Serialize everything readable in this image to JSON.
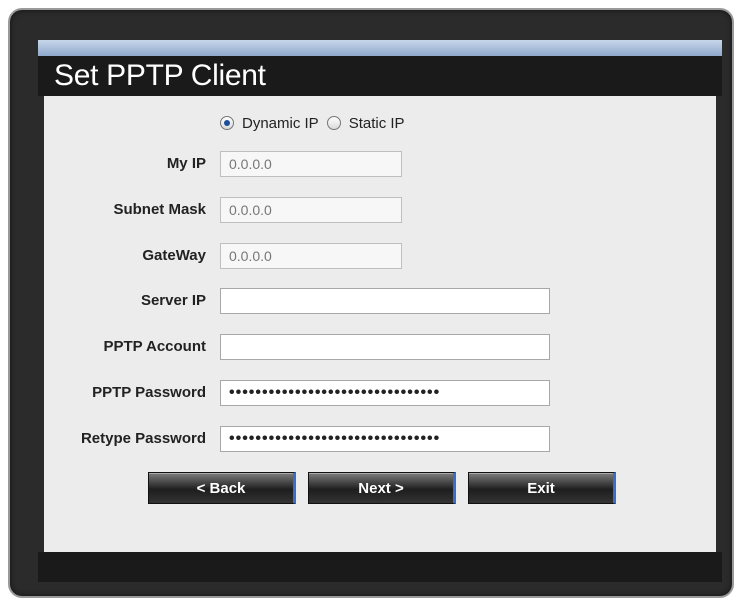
{
  "title": "Set PPTP Client",
  "mode": {
    "options": [
      {
        "label": "Dynamic IP",
        "selected": true
      },
      {
        "label": "Static IP",
        "selected": false
      }
    ]
  },
  "fields": {
    "my_ip": {
      "label": "My IP",
      "value": "0.0.0.0"
    },
    "subnet_mask": {
      "label": "Subnet Mask",
      "value": "0.0.0.0"
    },
    "gateway": {
      "label": "GateWay",
      "value": "0.0.0.0"
    },
    "server_ip": {
      "label": "Server IP",
      "value": ""
    },
    "pptp_account": {
      "label": "PPTP Account",
      "value": ""
    },
    "pptp_password": {
      "label": "PPTP Password",
      "value": "••••••••••••••••••••••••••••••••"
    },
    "retype_password": {
      "label": "Retype Password",
      "value": "••••••••••••••••••••••••••••••••"
    }
  },
  "buttons": {
    "back": "< Back",
    "next": "Next >",
    "exit": "Exit"
  },
  "colors": {
    "accent": "#3a6dc8",
    "panel": "#ececec",
    "frame": "#1a1a1a"
  }
}
